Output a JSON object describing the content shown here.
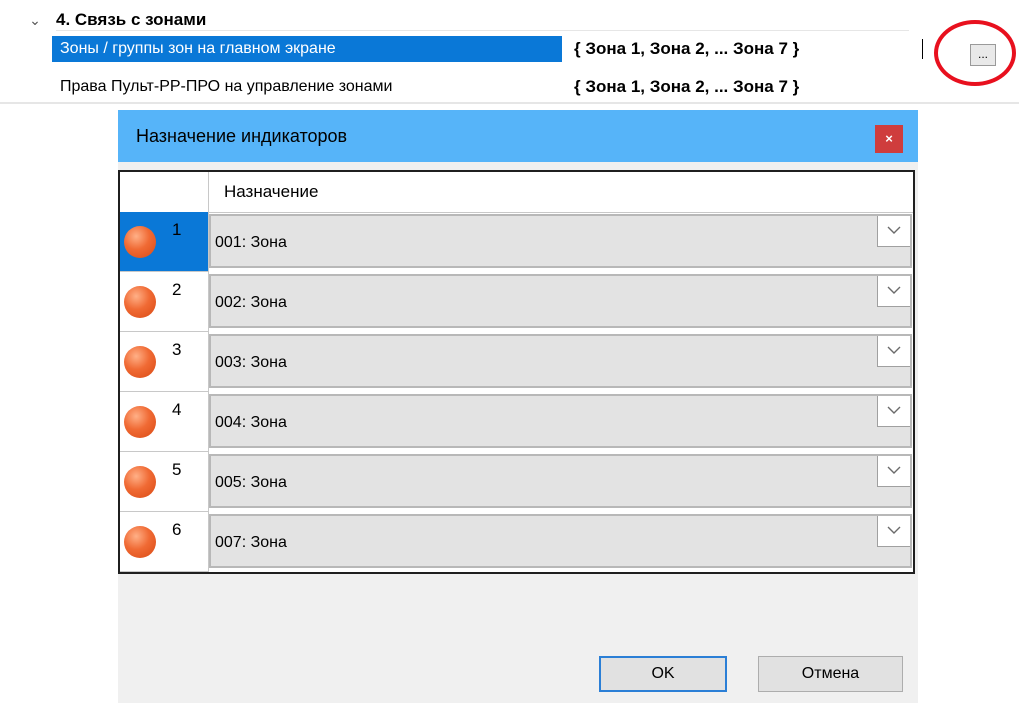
{
  "property_grid": {
    "category": {
      "toggle": "⌄",
      "title": "4. Связь с зонами"
    },
    "rows": [
      {
        "name": "Зоны / группы зон на главном экране",
        "value": "{ Зона 1, Зона 2, ... Зона 7 }"
      },
      {
        "name": "Права Пульт-РР-ПРО на управление зонами",
        "value": "{ Зона 1, Зона 2, ... Зона 7 }"
      }
    ],
    "ellipsis_label": "...",
    "highlight_color": "#e8101e",
    "selection_color": "#0a78d7"
  },
  "dialog": {
    "title": "Назначение индикаторов",
    "close_label": "×",
    "column_header": "Назначение",
    "rows": [
      {
        "num": "1",
        "value": "001: Зона",
        "selected": true
      },
      {
        "num": "2",
        "value": "002: Зона"
      },
      {
        "num": "3",
        "value": "003: Зона"
      },
      {
        "num": "4",
        "value": "004: Зона"
      },
      {
        "num": "5",
        "value": "005: Зона"
      },
      {
        "num": "6",
        "value": "007: Зона"
      }
    ],
    "ok_label": "OK",
    "cancel_label": "Отмена",
    "titlebar_color": "#56b4f9",
    "indicator_icon": "orange-indicator-icon"
  }
}
